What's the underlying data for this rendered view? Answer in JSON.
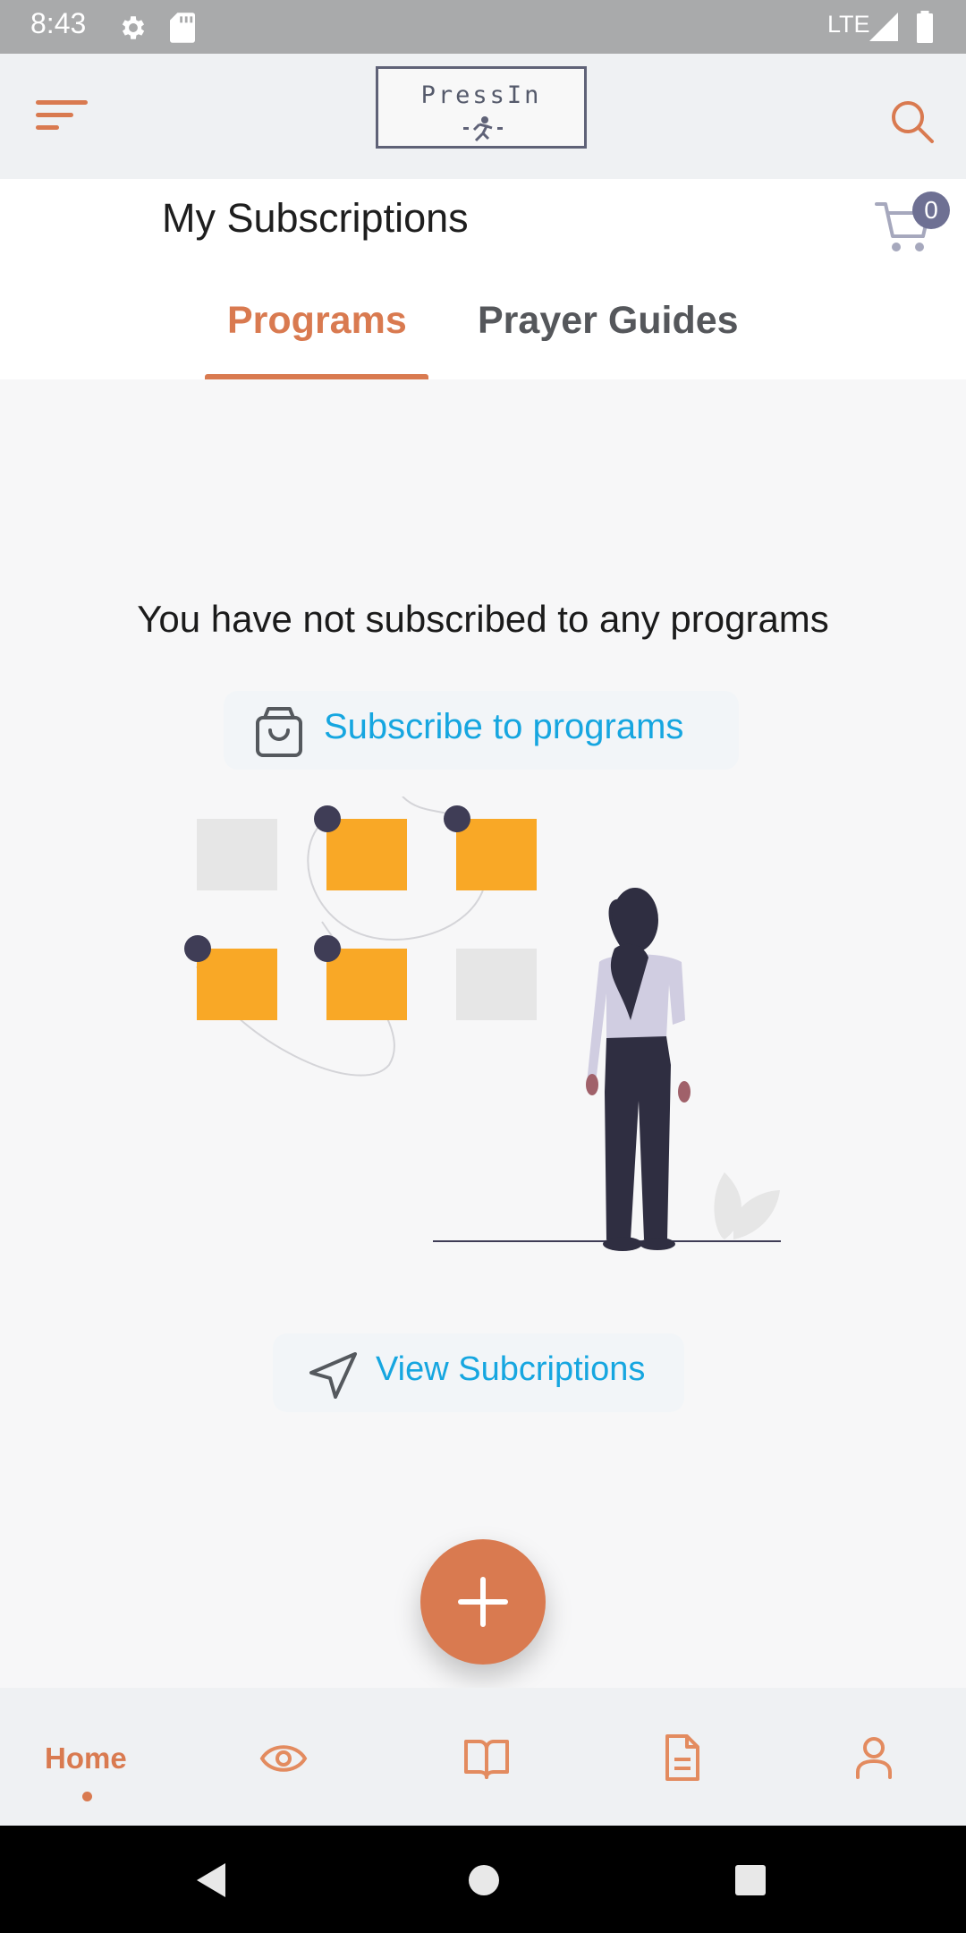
{
  "status_bar": {
    "time": "8:43",
    "network": "LTE",
    "icons": [
      "gear-icon",
      "sd-card-icon",
      "signal-icon",
      "battery-icon"
    ]
  },
  "app_bar": {
    "logo_text": "PressIn",
    "menu_icon": "menu-icon",
    "search_icon": "search-icon"
  },
  "page": {
    "title": "My Subscriptions",
    "cart_count": "0"
  },
  "tabs": [
    {
      "label": "Programs",
      "active": true
    },
    {
      "label": "Prayer Guides",
      "active": false
    }
  ],
  "empty_state": {
    "message": "You have not subscribed to any programs",
    "subscribe_label": "Subscribe to  programs",
    "view_label": "View Subcriptions"
  },
  "bottom_nav": {
    "home_label": "Home",
    "items": [
      "home",
      "eye-icon",
      "book-icon",
      "document-icon",
      "profile-icon"
    ]
  },
  "colors": {
    "accent": "#d97a50",
    "link": "#16a6e0",
    "yellow": "#f9a826",
    "dark": "#2f2e41"
  }
}
